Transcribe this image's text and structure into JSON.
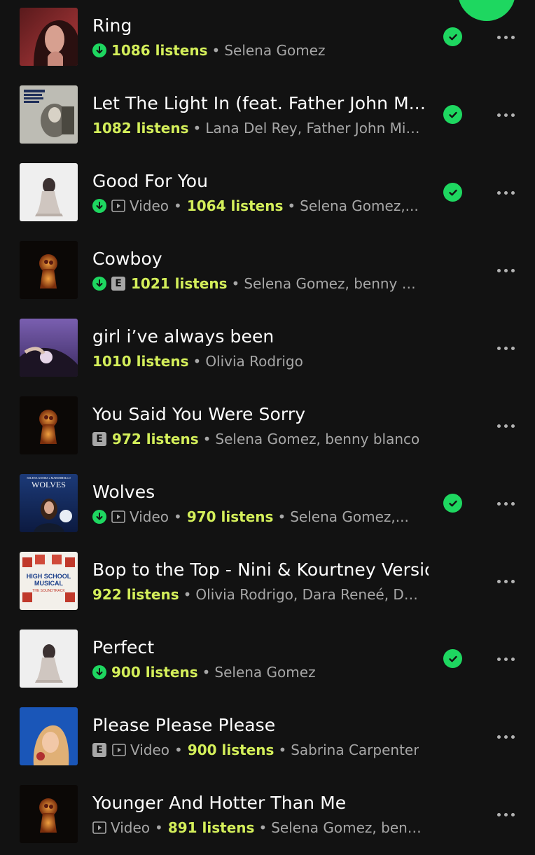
{
  "colors": {
    "background": "#121212",
    "accent_green": "#1ed760",
    "listens_yellow": "#d4ef5a",
    "secondary_text": "#a7a7a7"
  },
  "tracks": [
    {
      "title": "Ring",
      "downloaded": true,
      "explicit": false,
      "video": false,
      "listens": "1086 listens",
      "artists": "Selena Gomez",
      "liked": true,
      "art": "art-ring"
    },
    {
      "title": "Let The Light In (feat. Father John M...",
      "downloaded": false,
      "explicit": false,
      "video": false,
      "listens": "1082 listens",
      "artists": "Lana Del Rey, Father John Mis...",
      "liked": true,
      "art": "art-lana"
    },
    {
      "title": "Good For You",
      "downloaded": true,
      "explicit": false,
      "video": true,
      "video_label": "Video",
      "listens": "1064 listens",
      "artists": "Selena Gomez,...",
      "liked": true,
      "art": "art-revival"
    },
    {
      "title": "Cowboy",
      "downloaded": true,
      "explicit": true,
      "explicit_label": "E",
      "video": false,
      "listens": "1021 listens",
      "artists": "Selena Gomez, benny blanco",
      "liked": false,
      "art": "art-keyhole"
    },
    {
      "title": "girl i’ve always been",
      "downloaded": false,
      "explicit": false,
      "video": false,
      "listens": "1010 listens",
      "artists": "Olivia Rodrigo",
      "liked": false,
      "art": "art-guts"
    },
    {
      "title": "You Said You Were Sorry",
      "downloaded": false,
      "explicit": true,
      "explicit_label": "E",
      "video": false,
      "listens": "972 listens",
      "artists": "Selena Gomez, benny blanco",
      "liked": false,
      "art": "art-keyhole"
    },
    {
      "title": "Wolves",
      "downloaded": true,
      "explicit": false,
      "video": true,
      "video_label": "Video",
      "listens": "970 listens",
      "artists": "Selena Gomez,...",
      "liked": true,
      "art": "art-wolves",
      "art_text": "WOLVES",
      "art_subtext": "SELENA GOMEZ x MARSHMELLO"
    },
    {
      "title": "Bop to the Top - Nini & Kourtney Version",
      "downloaded": false,
      "explicit": false,
      "video": false,
      "listens": "922 listens",
      "artists": "Olivia Rodrigo, Dara Reneé, Disney",
      "liked": false,
      "art": "art-hsm",
      "art_text": "HIGH SCHOOL MUSICAL",
      "art_subtext": "THE SOUNDTRACK"
    },
    {
      "title": "Perfect",
      "downloaded": true,
      "explicit": false,
      "video": false,
      "listens": "900 listens",
      "artists": "Selena Gomez",
      "liked": true,
      "art": "art-revival"
    },
    {
      "title": "Please Please Please",
      "downloaded": false,
      "explicit": true,
      "explicit_label": "E",
      "video": true,
      "video_label": "Video",
      "listens": "900 listens",
      "artists": "Sabrina Carpenter",
      "liked": false,
      "art": "art-sabrina"
    },
    {
      "title": "Younger And Hotter Than Me",
      "downloaded": false,
      "explicit": false,
      "video": true,
      "video_label": "Video",
      "listens": "891 listens",
      "artists": "Selena Gomez, benny bla...",
      "liked": false,
      "art": "art-keyhole"
    }
  ]
}
